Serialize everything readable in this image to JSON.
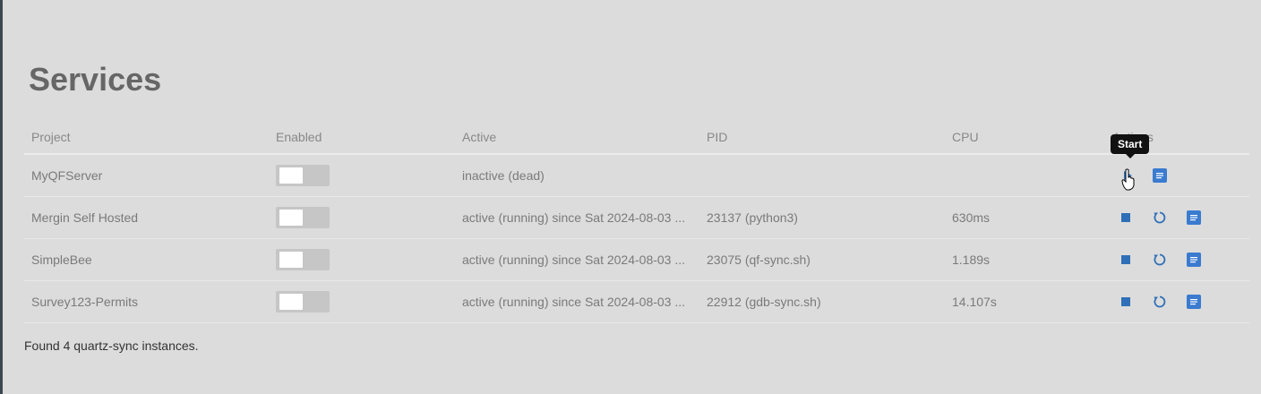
{
  "page": {
    "title": "Services"
  },
  "table": {
    "headers": {
      "project": "Project",
      "enabled": "Enabled",
      "active": "Active",
      "pid": "PID",
      "cpu": "CPU",
      "actions": "Actions"
    },
    "rows": [
      {
        "project": "MyQFServer",
        "enabled": false,
        "active": "inactive (dead)",
        "pid": "",
        "cpu": "",
        "running": false
      },
      {
        "project": "Mergin Self Hosted",
        "enabled": false,
        "active": "active (running) since Sat 2024-08-03 ...",
        "pid": "23137 (python3)",
        "cpu": "630ms",
        "running": true
      },
      {
        "project": "SimpleBee",
        "enabled": false,
        "active": "active (running) since Sat 2024-08-03 ...",
        "pid": "23075 (qf-sync.sh)",
        "cpu": "1.189s",
        "running": true
      },
      {
        "project": "Survey123-Permits",
        "enabled": false,
        "active": "active (running) since Sat 2024-08-03 ...",
        "pid": "22912 (gdb-sync.sh)",
        "cpu": "14.107s",
        "running": true
      }
    ]
  },
  "tooltip": {
    "text": "Start"
  },
  "footer": {
    "text": "Found 4 quartz-sync instances."
  },
  "icons": {
    "start": "play-icon",
    "stop": "stop-icon",
    "restart": "restart-icon",
    "logs": "log-icon"
  },
  "colors": {
    "accent": "#2f6fb7",
    "background": "#dcdcdc"
  }
}
